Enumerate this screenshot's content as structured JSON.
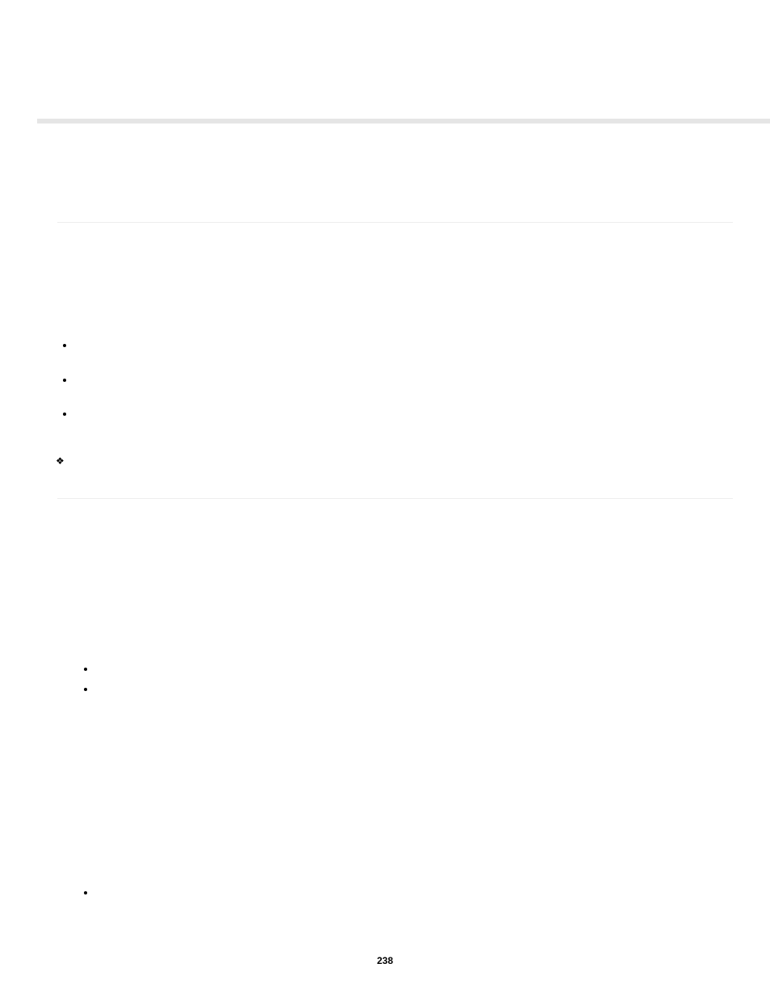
{
  "page_number": "238",
  "diamond_glyph": "❖"
}
